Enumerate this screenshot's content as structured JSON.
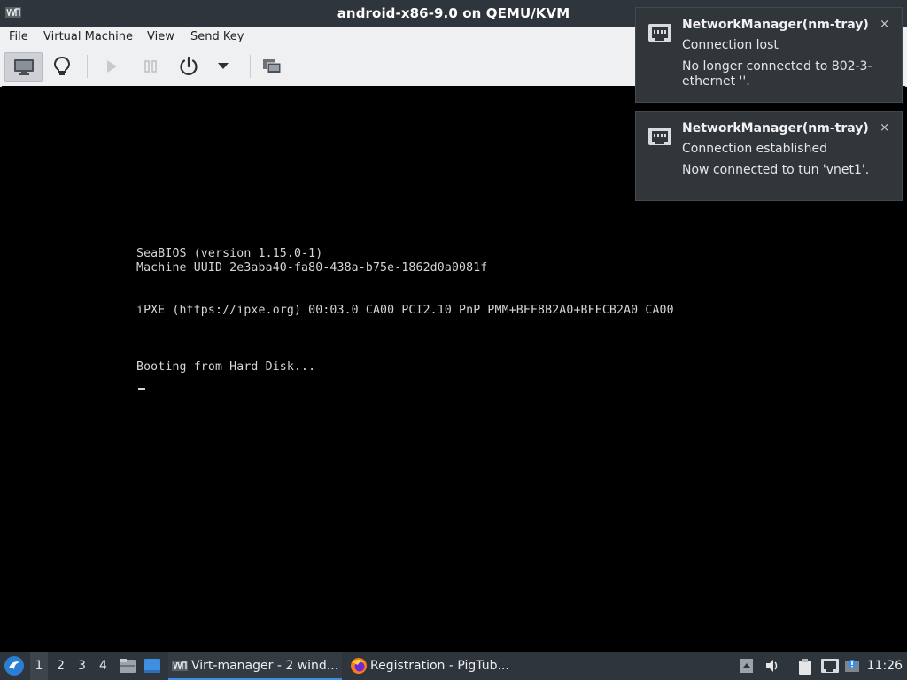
{
  "window": {
    "title": "android-x86-9.0 on QEMU/KVM",
    "app_icon": "virt-manager-icon"
  },
  "menubar": {
    "items": [
      "File",
      "Virtual Machine",
      "View",
      "Send Key"
    ]
  },
  "toolbar": {
    "buttons": [
      {
        "name": "console-view-button",
        "icon": "monitor-icon",
        "active": true
      },
      {
        "name": "details-view-button",
        "icon": "lightbulb-icon"
      },
      {
        "name": "run-button",
        "icon": "play-icon",
        "enabled": false
      },
      {
        "name": "pause-button",
        "icon": "pause-icon",
        "enabled": false
      },
      {
        "name": "shutdown-button",
        "icon": "power-icon"
      },
      {
        "name": "shutdown-menu-button",
        "icon": "chevron-down-icon"
      },
      {
        "name": "fullscreen-button",
        "icon": "screens-icon"
      }
    ]
  },
  "console": {
    "lines": [
      "SeaBIOS (version 1.15.0-1)",
      "Machine UUID 2e3aba40-fa80-438a-b75e-1862d0a0081f",
      "iPXE (https://ipxe.org) 00:03.0 CA00 PCI2.10 PnP PMM+BFF8B2A0+BFECB2A0 CA00",
      "Booting from Hard Disk..."
    ]
  },
  "notifications": [
    {
      "icon": "network-wired-icon",
      "title": "NetworkManager(nm-tray)",
      "summary": "Connection lost",
      "body": "No longer connected to 802-3-ethernet ''.",
      "close": "×"
    },
    {
      "icon": "network-wired-icon",
      "title": "NetworkManager(nm-tray)",
      "summary": "Connection established",
      "body": "Now connected to tun 'vnet1'.",
      "close": "×"
    }
  ],
  "taskbar": {
    "workspaces": [
      "1",
      "2",
      "3",
      "4"
    ],
    "active_workspace": "1",
    "tasks": [
      {
        "label": "Virt-manager - 2 wind...",
        "icon": "virt-manager-icon",
        "active": true
      },
      {
        "label": "Registration - PigTub...",
        "icon": "firefox-icon",
        "active": false
      }
    ],
    "clock": "11:26"
  },
  "colors": {
    "titlebar": "#2f353d",
    "notification_bg": "#31363b",
    "task_accent": "#3d8ee6"
  }
}
